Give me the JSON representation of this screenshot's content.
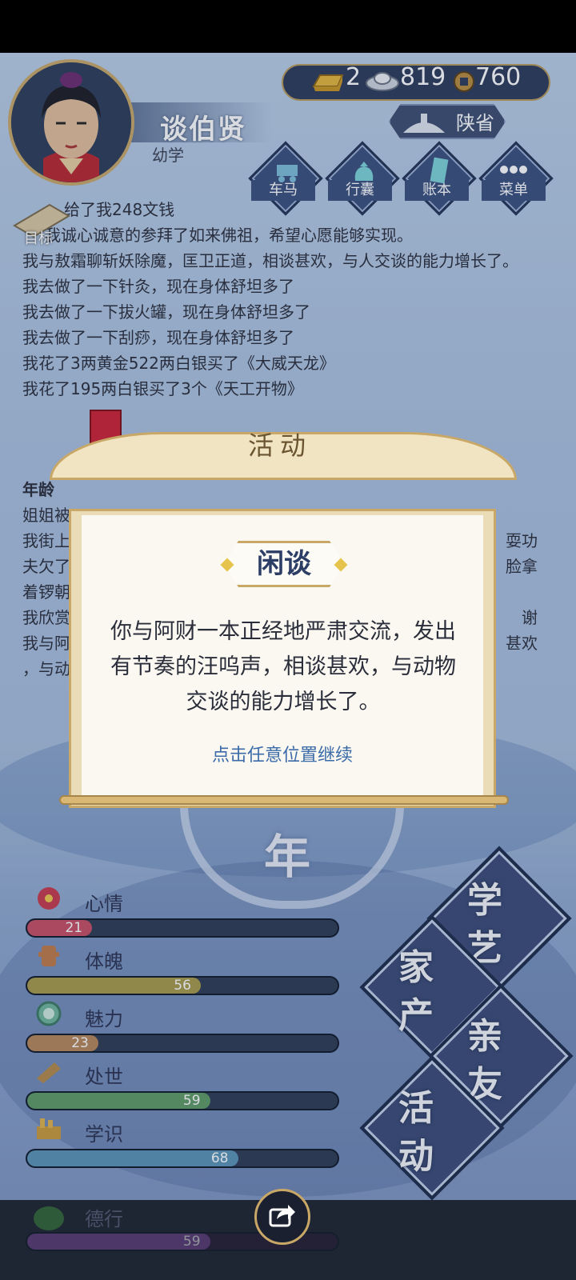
{
  "player": {
    "name": "谈伯贤",
    "stage": "幼学",
    "region": "陕省"
  },
  "resources": {
    "gold": "2",
    "silver": "819",
    "copper": "760"
  },
  "menu": [
    {
      "label": "车马",
      "icon": "carriage-icon"
    },
    {
      "label": "行囊",
      "icon": "bag-icon"
    },
    {
      "label": "账本",
      "icon": "ledger-icon"
    },
    {
      "label": "菜单",
      "icon": "more-icon"
    }
  ],
  "goal_label": "目标",
  "log_lines": [
    "给了我248文钱",
    "我诚心诚意的参拜了如来佛祖，希望心愿能够实现。",
    "我与敖霜聊斩妖除魔，匡卫正道，相谈甚欢，与人交谈的能力增长了。",
    "我去做了一下针灸，现在身体舒坦多了",
    "我去做了一下拔火罐，现在身体舒坦多了",
    "我去做了一下刮痧，现在身体舒坦多了",
    "我花了3两黄金522两白银买了《大威天龙》",
    "我花了195两白银买了3个《天工开物》"
  ],
  "log2": {
    "header": "年龄",
    "lines_left": [
      "姐姐被",
      "我街上",
      "夫欠了",
      "着锣朝",
      "我欣赏",
      "我与阿",
      "，与动"
    ],
    "lines_right": [
      "",
      "耍功",
      "脸拿",
      "",
      "谢",
      "甚欢",
      ""
    ]
  },
  "dialog": {
    "banner": "活动",
    "tag": "闲谈",
    "message": "你与阿财一本正经地严肃交流，发出有节奏的汪呜声，相谈甚欢，与动物交谈的能力增长了。",
    "continue": "点击任意位置继续"
  },
  "year_char": "年",
  "stats": [
    {
      "label": "心情",
      "value": 21,
      "icon": "flower-icon",
      "color": "#c94d63"
    },
    {
      "label": "体魄",
      "value": 56,
      "icon": "body-icon",
      "color": "#a89a4a"
    },
    {
      "label": "魅力",
      "value": 23,
      "icon": "charm-icon",
      "color": "#b8875a"
    },
    {
      "label": "处世",
      "value": 59,
      "icon": "scroll-icon",
      "color": "#5f9a63"
    },
    {
      "label": "学识",
      "value": 68,
      "icon": "books-icon",
      "color": "#5a93b6"
    },
    {
      "label": "德行",
      "value": 59,
      "icon": "virtue-icon",
      "color": "#7a4a9e"
    }
  ],
  "actions": [
    "学艺",
    "家产",
    "亲友",
    "活动"
  ]
}
